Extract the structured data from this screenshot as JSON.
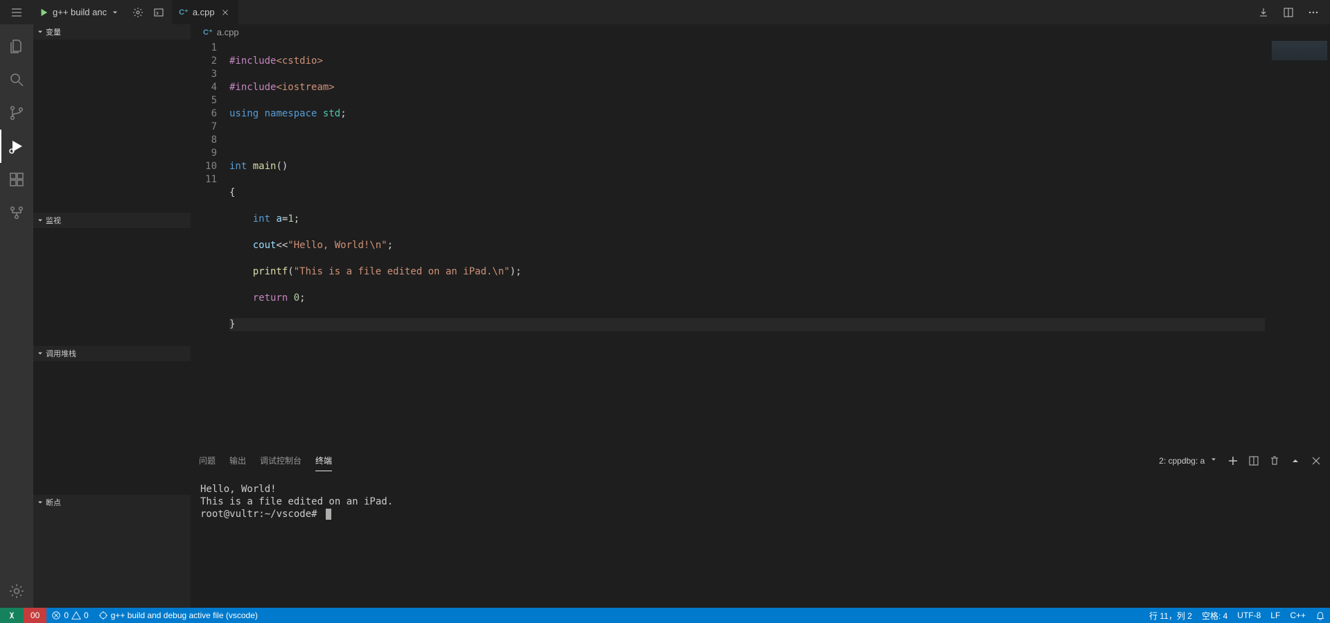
{
  "top": {
    "run_config": "g++ build anc",
    "tab_file": "a.cpp",
    "breadcrumb": "a.cpp"
  },
  "sidebar": {
    "variables": "变量",
    "watch": "监视",
    "callstack": "调用堆栈",
    "breakpoints": "断点"
  },
  "code": {
    "lines": [
      {
        "n": "1"
      },
      {
        "n": "2"
      },
      {
        "n": "3"
      },
      {
        "n": "4"
      },
      {
        "n": "5"
      },
      {
        "n": "6"
      },
      {
        "n": "7"
      },
      {
        "n": "8"
      },
      {
        "n": "9"
      },
      {
        "n": "10"
      },
      {
        "n": "11"
      }
    ],
    "l1a": "#include",
    "l1b": "<cstdio>",
    "l2a": "#include",
    "l2b": "<iostream>",
    "l3a": "using",
    "l3b": "namespace",
    "l3c": "std",
    "l3d": ";",
    "l5a": "int",
    "l5b": "main",
    "l5c": "()",
    "l6": "{",
    "l7a": "int",
    "l7b": "a",
    "l7c": "=",
    "l7d": "1",
    "l7e": ";",
    "l8a": "cout",
    "l8b": "<<",
    "l8c": "\"Hello, World!\\n\"",
    "l8d": ";",
    "l9a": "printf",
    "l9b": "(",
    "l9c": "\"This is a file edited on an iPad.\\n\"",
    "l9d": ");",
    "l10a": "return",
    "l10b": "0",
    "l10c": ";",
    "l11": "}"
  },
  "panel": {
    "tabs": {
      "problems": "问题",
      "output": "输出",
      "debug": "调试控制台",
      "terminal": "终端"
    },
    "terminal_selector": "2: cppdbg: a"
  },
  "terminal": {
    "line1": "Hello, World!",
    "line2": "This is a file edited on an iPad.",
    "prompt": "root@vultr:~/vscode# "
  },
  "status": {
    "redacted": "            00",
    "errors": "0",
    "warnings": "0",
    "task": "g++ build and debug active file (vscode)",
    "pos": "行 11，列 2",
    "spaces": "空格: 4",
    "encoding": "UTF-8",
    "eol": "LF",
    "lang": "C++"
  }
}
